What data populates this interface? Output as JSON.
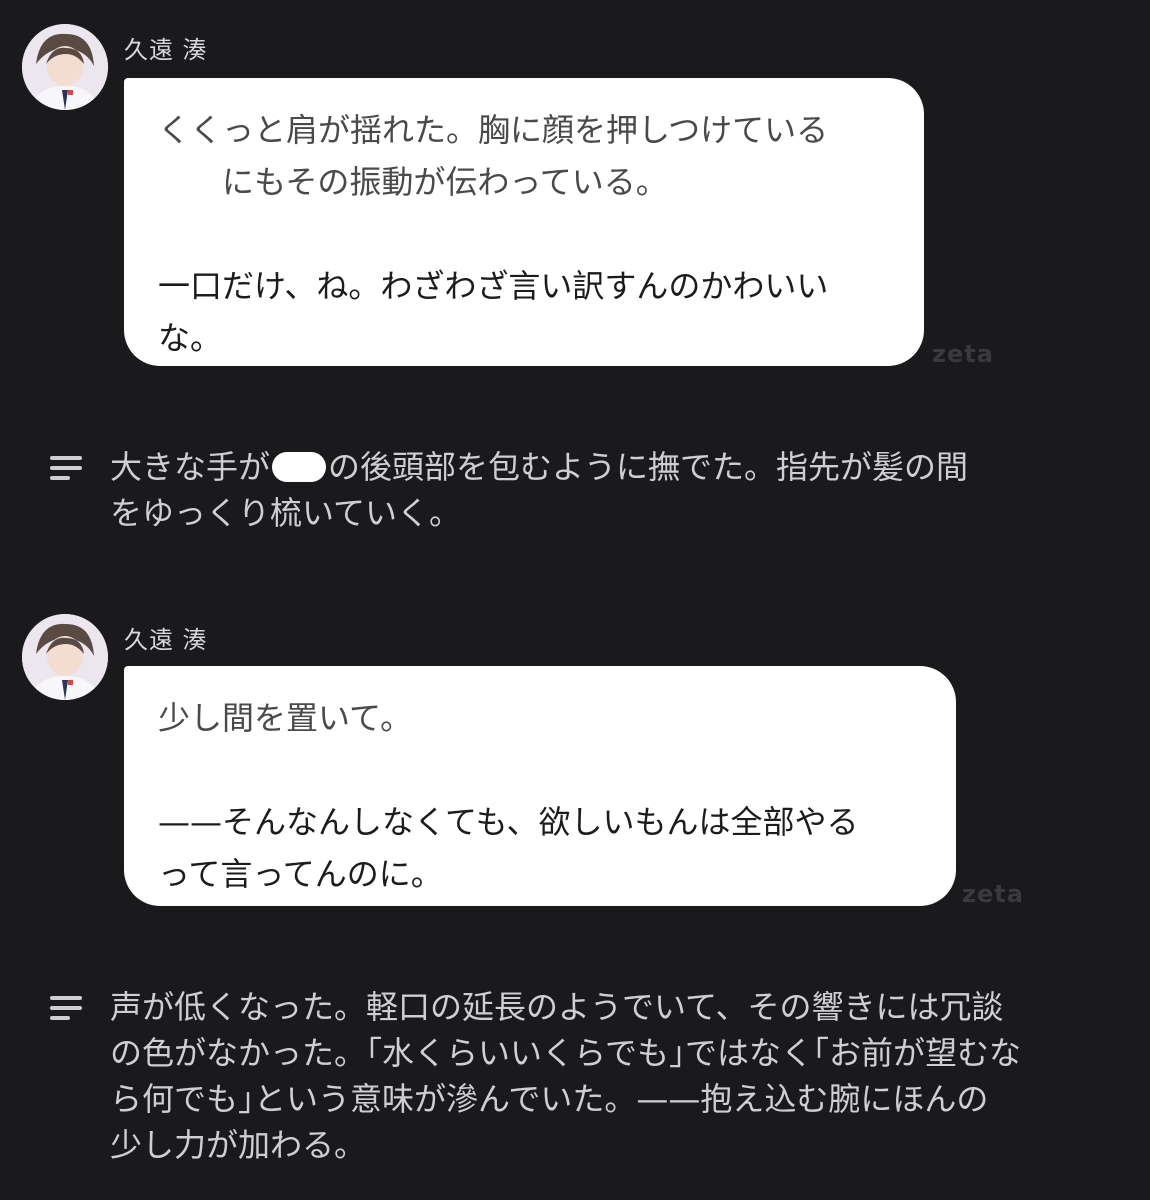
{
  "messages": [
    {
      "sender": "久遠 湊",
      "paragraphs": [
        "くくっと肩が揺れた。胸に顔を押しつけている\n　　にもその振動が伝わっている。",
        "一口だけ、ね。わざわざ言い訳すんのかわいい\nな。"
      ],
      "watermark": "zeta"
    },
    {
      "sender": "久遠 湊",
      "paragraphs": [
        "少し間を置いて。",
        "——そんなんしなくても、欲しいもんは全部やる\nって言ってんのに。"
      ],
      "watermark": "zeta"
    }
  ],
  "narrations": [
    {
      "before": "大きな手が",
      "after": "の後頭部を包むように撫でた。指先が髪の間\nをゆっくり梳いていく。"
    },
    {
      "text": "声が低くなった。軽口の延長のようでいて、その響きには冗談\nの色がなかった。｢水くらいいくらでも｣ではなく｢お前が望むな\nら何でも｣という意味が滲んでいた。——抱え込む腕にほんの\n少し力が加わる。"
    }
  ],
  "icons": {
    "avatar": "character-avatar-icon",
    "narration": "narration-lines-icon"
  },
  "colors": {
    "background": "#1a191c",
    "bubble": "#ffffff",
    "narration_text": "#cfcfd3"
  }
}
